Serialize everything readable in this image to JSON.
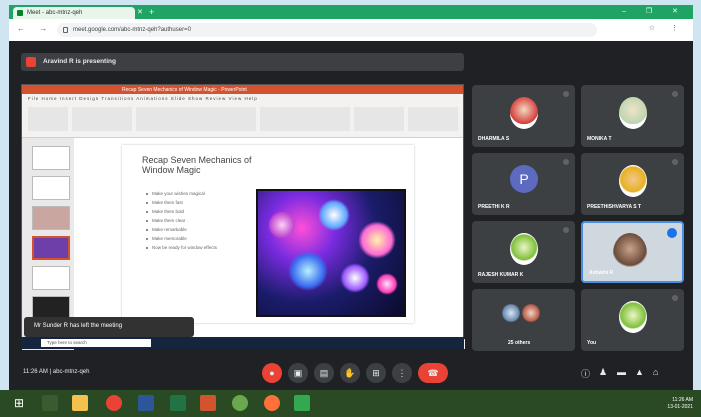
{
  "browser": {
    "tab_title": "Meet - abc-mtnz-qeh",
    "tab_close": "✕",
    "new_tab": "+",
    "window_controls": "– ❐ ✕",
    "nav": "← → C",
    "url": "meet.google.com/abc-mtnz-qeh?authuser=0",
    "extensions": "☆ ⋮"
  },
  "presenter_banner": "Aravind R is presenting",
  "ppt": {
    "window_title": "Recap Seven Mechanics of Window Magic - PowerPoint",
    "ribbon_tabs": "File  Home  Insert  Design  Transitions  Animations  Slide Show  Review  View  Help",
    "slide": {
      "title": "Recap Seven Mechanics of Window Magic",
      "bullets": [
        "Make your wishes magical",
        "Make them fast",
        "Make them bold",
        "Make them clear",
        "Make remarkable",
        "Make memorable",
        "Now be ready for window effects"
      ]
    }
  },
  "toast": "Mr Sunder R has left the meeting",
  "inner_search": "Type here to search",
  "participants": [
    {
      "name": "DHARMILA S",
      "avatar": "photo"
    },
    {
      "name": "MONIKA T",
      "avatar": "photo"
    },
    {
      "name": "PREETHI K R",
      "avatar": "P"
    },
    {
      "name": "PREETHISHVARYA S T",
      "avatar": "photo"
    },
    {
      "name": "RAJESH KUMAR K",
      "avatar": "photo"
    },
    {
      "name": "Ashwini R",
      "avatar": "video"
    },
    {
      "name": "25 others",
      "avatar": "group"
    },
    {
      "name": "You",
      "avatar": "photo"
    }
  ],
  "callbar": {
    "meeting_info": "11:26 AM  |  abc-mtnz-qeh",
    "controls": [
      "mic-off",
      "camera-off",
      "captions",
      "raise-hand",
      "present",
      "more"
    ],
    "end_call": "☎"
  },
  "windows_clock": {
    "time": "11:26 AM",
    "date": "13-01-2021"
  },
  "colors": {
    "meet_bg": "#202124",
    "tile_bg": "#3c4043",
    "end_call": "#ea4335",
    "ppt_accent": "#d35230",
    "chrome_tabstrip": "#1fa463"
  }
}
